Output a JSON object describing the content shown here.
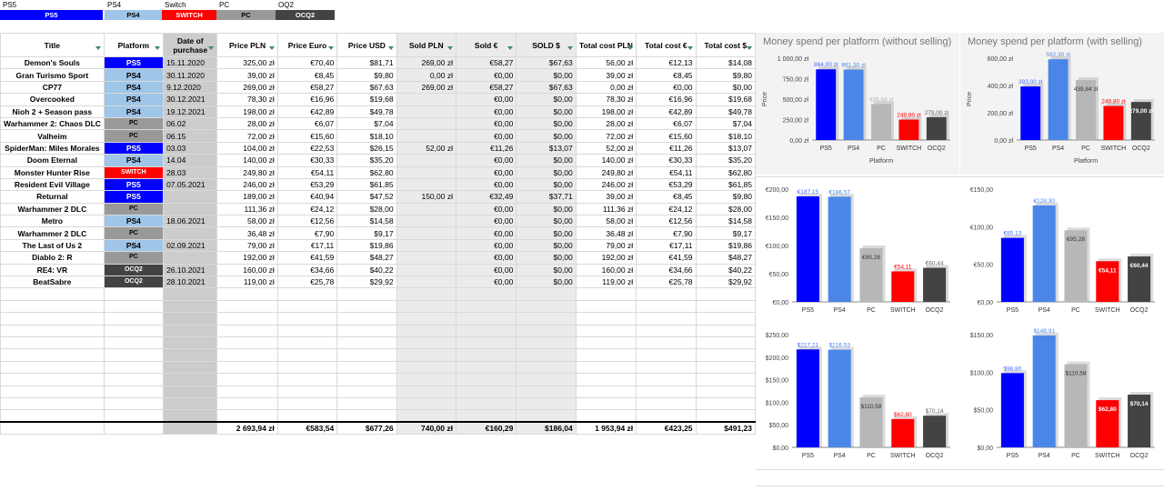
{
  "legend": {
    "items": [
      {
        "name": "PS5",
        "chip": "PS5",
        "bg": "#0000ff",
        "fg": "#ffffff"
      },
      {
        "name": "PS4",
        "chip": "PS4",
        "bg": "#9fc5e8",
        "fg": "#000000"
      },
      {
        "name": "Switch",
        "chip": "SWITCH",
        "bg": "#ff0000",
        "fg": "#ffffff"
      },
      {
        "name": "PC",
        "chip": "PC",
        "bg": "#999999",
        "fg": "#000000"
      },
      {
        "name": "OQ2",
        "chip": "OCQ2",
        "bg": "#434343",
        "fg": "#ffffff"
      }
    ]
  },
  "table": {
    "headers": [
      "Title",
      "Platform",
      "Date of purchase",
      "Price PLN",
      "Price Euro",
      "Price USD",
      "Sold PLN",
      "Sold €",
      "SOLD $",
      "Total cost PLN",
      "Total cost €",
      "Total cost $"
    ],
    "rows": [
      [
        "Demon's Souls",
        "PS5",
        "15.11.2020",
        "325,00 zł",
        "€70,40",
        "$81,71",
        "269,00 zł",
        "€58,27",
        "$67,63",
        "56,00 zł",
        "€12,13",
        "$14,08"
      ],
      [
        "Gran Turismo Sport",
        "PS4",
        "30.11.2020",
        "39,00 zł",
        "€8,45",
        "$9,80",
        "0,00 zł",
        "€0,00",
        "$0,00",
        "39,00 zł",
        "€8,45",
        "$9,80"
      ],
      [
        "CP77",
        "PS4",
        "9.12.2020",
        "269,00 zł",
        "€58,27",
        "$67,63",
        "269,00 zł",
        "€58,27",
        "$67,63",
        "0,00 zł",
        "€0,00",
        "$0,00"
      ],
      [
        "Overcooked",
        "PS4",
        "30.12.2021",
        "78,30 zł",
        "€16,96",
        "$19,68",
        "",
        "€0,00",
        "$0,00",
        "78,30 zł",
        "€16,96",
        "$19,68"
      ],
      [
        "Nioh 2 + Season pass",
        "PS4",
        "19.12.2021",
        "198,00 zł",
        "€42,89",
        "$49,78",
        "",
        "€0,00",
        "$0,00",
        "198,00 zł",
        "€42,89",
        "$49,78"
      ],
      [
        "Warhammer 2: Chaos DLC",
        "PC",
        "06.02",
        "28,00 zł",
        "€6,07",
        "$7,04",
        "",
        "€0,00",
        "$0,00",
        "28,00 zł",
        "€6,07",
        "$7,04"
      ],
      [
        "Valheim",
        "PC",
        "06.15",
        "72,00 zł",
        "€15,60",
        "$18,10",
        "",
        "€0,00",
        "$0,00",
        "72,00 zł",
        "€15,60",
        "$18,10"
      ],
      [
        "SpiderMan: Miles Morales",
        "PS5",
        "03.03",
        "104,00 zł",
        "€22,53",
        "$26,15",
        "52,00 zł",
        "€11,26",
        "$13,07",
        "52,00 zł",
        "€11,26",
        "$13,07"
      ],
      [
        "Doom Eternal",
        "PS4",
        "14.04",
        "140,00 zł",
        "€30,33",
        "$35,20",
        "",
        "€0,00",
        "$0,00",
        "140,00 zł",
        "€30,33",
        "$35,20"
      ],
      [
        "Monster Hunter Rise",
        "SWITCH",
        "28.03",
        "249,80 zł",
        "€54,11",
        "$62,80",
        "",
        "€0,00",
        "$0,00",
        "249,80 zł",
        "€54,11",
        "$62,80"
      ],
      [
        "Resident Evil Village",
        "PS5",
        "07.05.2021",
        "246,00 zł",
        "€53,29",
        "$61,85",
        "",
        "€0,00",
        "$0,00",
        "246,00 zł",
        "€53,29",
        "$61,85"
      ],
      [
        "Returnal",
        "PS5",
        "",
        "189,00 zł",
        "€40,94",
        "$47,52",
        "150,00 zł",
        "€32,49",
        "$37,71",
        "39,00 zł",
        "€8,45",
        "$9,80"
      ],
      [
        "Warhammer 2 DLC",
        "PC",
        "",
        "111,36 zł",
        "€24,12",
        "$28,00",
        "",
        "€0,00",
        "$0,00",
        "111,36 zł",
        "€24,12",
        "$28,00"
      ],
      [
        "Metro",
        "PS4",
        "18.06.2021",
        "58,00 zł",
        "€12,56",
        "$14,58",
        "",
        "€0,00",
        "$0,00",
        "58,00 zł",
        "€12,56",
        "$14,58"
      ],
      [
        "Warhammer 2 DLC",
        "PC",
        "",
        "36,48 zł",
        "€7,90",
        "$9,17",
        "",
        "€0,00",
        "$0,00",
        "36,48 zł",
        "€7,90",
        "$9,17"
      ],
      [
        "The Last of Us 2",
        "PS4",
        "02.09.2021",
        "79,00 zł",
        "€17,11",
        "$19,86",
        "",
        "€0,00",
        "$0,00",
        "79,00 zł",
        "€17,11",
        "$19,86"
      ],
      [
        "Diablo 2: R",
        "PC",
        "",
        "192,00 zł",
        "€41,59",
        "$48,27",
        "",
        "€0,00",
        "$0,00",
        "192,00 zł",
        "€41,59",
        "$48,27"
      ],
      [
        "RE4: VR",
        "OCQ2",
        "26.10.2021",
        "160,00 zł",
        "€34,66",
        "$40,22",
        "",
        "€0,00",
        "$0,00",
        "160,00 zł",
        "€34,66",
        "$40,22"
      ],
      [
        "BeatSabre",
        "OCQ2",
        "28.10.2021",
        "119,00 zł",
        "€25,78",
        "$29,92",
        "",
        "€0,00",
        "$0,00",
        "119,00 zł",
        "€25,78",
        "$29,92"
      ]
    ],
    "totals": [
      "",
      "",
      "",
      "2 693,94 zł",
      "€583,54",
      "$677,26",
      "740,00 zł",
      "€160,29",
      "$186,04",
      "1 953,94 zł",
      "€423,25",
      "$491,23"
    ]
  },
  "chart_data": [
    {
      "type": "bar",
      "title": "Money spend per platform (without selling)",
      "xlabel": "Platform",
      "ylabel": "Price",
      "categories": [
        "PS5",
        "PS4",
        "PC",
        "SWITCH",
        "OCQ2"
      ],
      "values": [
        864.0,
        861.3,
        439.84,
        249.8,
        279.0
      ],
      "labels": [
        "864,00 zł",
        "861,30 zł",
        "439,84 zł",
        "249,80 zł",
        "279,00 zł"
      ],
      "ylim": [
        0,
        1000
      ],
      "yticks": [
        "0,00 zł",
        "250,00 zł",
        "500,00 zł",
        "750,00 zł",
        "1 000,00 zł"
      ]
    },
    {
      "type": "bar",
      "title": "Money spend per platform (with selling)",
      "xlabel": "Platform",
      "ylabel": "Price",
      "categories": [
        "PS5",
        "PS4",
        "PC",
        "SWITCH",
        "OCQ2"
      ],
      "values": [
        393.0,
        592.3,
        439.84,
        249.8,
        279.0
      ],
      "labels": [
        "393,00 zł",
        "592,30 zł",
        "439,84 zł",
        "249,80 zł",
        "279,00 zł"
      ],
      "ylim": [
        0,
        600
      ],
      "yticks": [
        "0,00 zł",
        "200,00 zł",
        "400,00 zł",
        "600,00 zł"
      ]
    },
    {
      "type": "bar",
      "title": "",
      "xlabel": "",
      "ylabel": "",
      "categories": [
        "PS5",
        "PS4",
        "PC",
        "SWITCH",
        "OCQ2"
      ],
      "values": [
        187.15,
        186.57,
        95.28,
        54.11,
        60.44
      ],
      "labels": [
        "€187,15",
        "€186,57",
        "€95,28",
        "€54,11",
        "€60,44"
      ],
      "ylim": [
        0,
        200
      ],
      "yticks": [
        "€0,00",
        "€50,00",
        "€100,00",
        "€150,00",
        "€200,00"
      ]
    },
    {
      "type": "bar",
      "title": "",
      "xlabel": "",
      "ylabel": "",
      "categories": [
        "PS5",
        "PS4",
        "PC",
        "SWITCH",
        "OCQ2"
      ],
      "values": [
        85.13,
        128.3,
        95.28,
        54.11,
        60.44
      ],
      "labels": [
        "€85,13",
        "€128,30",
        "€95,28",
        "€54,11",
        "€60,44"
      ],
      "ylim": [
        0,
        150
      ],
      "yticks": [
        "€0,00",
        "€50,00",
        "€100,00",
        "€150,00"
      ]
    },
    {
      "type": "bar",
      "title": "",
      "xlabel": "",
      "ylabel": "",
      "categories": [
        "PS5",
        "PS4",
        "PC",
        "SWITCH",
        "OCQ2"
      ],
      "values": [
        217.21,
        216.53,
        110.58,
        62.8,
        70.14
      ],
      "labels": [
        "$217,21",
        "$216,53",
        "$110,58",
        "$62,80",
        "$70,14"
      ],
      "ylim": [
        0,
        250
      ],
      "yticks": [
        "$0,00",
        "$50,00",
        "$100,00",
        "$150,00",
        "$200,00",
        "$250,00"
      ]
    },
    {
      "type": "bar",
      "title": "",
      "xlabel": "",
      "ylabel": "",
      "categories": [
        "PS5",
        "PS4",
        "PC",
        "SWITCH",
        "OCQ2"
      ],
      "values": [
        98.8,
        148.91,
        110.58,
        62.8,
        70.14
      ],
      "labels": [
        "$98,80",
        "$148,91",
        "$110,58",
        "$62,80",
        "$70,14"
      ],
      "ylim": [
        0,
        150
      ],
      "yticks": [
        "$0,00",
        "$50,00",
        "$100,00",
        "$150,00"
      ]
    }
  ],
  "colors": {
    "ps5": "#0000ff",
    "ps4": "#4a86e8",
    "pc": "#b7b7b7",
    "switch": "#ff0000",
    "ocq2": "#434343",
    "date_col": "#cccccc",
    "sold_col": "#ebebeb",
    "grid": "#d9d9d9",
    "filter_icon": "#3c8c5a"
  }
}
